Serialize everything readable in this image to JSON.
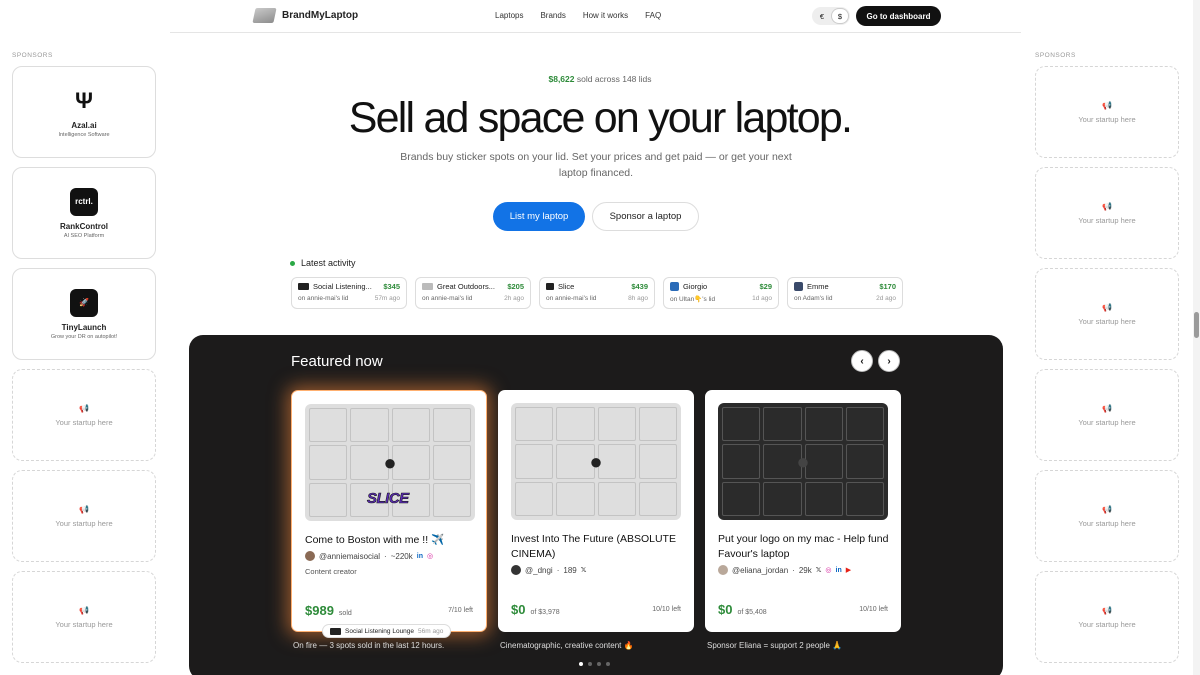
{
  "header": {
    "brand": "BrandMyLaptop",
    "nav": [
      "Laptops",
      "Brands",
      "How it works",
      "FAQ"
    ],
    "currency": {
      "options": [
        "€",
        "$"
      ],
      "selected": "$"
    },
    "dashboard_label": "Go to dashboard"
  },
  "sponsors": {
    "label": "SPONSORS",
    "left": [
      {
        "name": "Azal.ai",
        "tagline": "Intelligence Software",
        "logo": "Ψ"
      },
      {
        "name": "RankControl",
        "tagline": "AI SEO Platform",
        "logo": "rctrl."
      },
      {
        "name": "TinyLaunch",
        "tagline": "Grow your DR on autopilot!",
        "logo": "🚀"
      }
    ],
    "placeholder": "Your startup here",
    "placeholder_icon": "megaphone-icon"
  },
  "hero": {
    "stat_amount": "$8,622",
    "stat_rest": "sold across 148 lids",
    "title": "Sell ad space on your laptop.",
    "subtitle": "Brands buy sticker spots on your lid. Set your prices and get paid — or get your next laptop financed.",
    "cta_primary": "List my laptop",
    "cta_secondary": "Sponsor a laptop"
  },
  "activity": {
    "title": "Latest activity",
    "items": [
      {
        "name": "Social Listening...",
        "price": "$345",
        "lid": "on annie-mai's lid",
        "ago": "57m ago"
      },
      {
        "name": "Great Outdoors...",
        "price": "$205",
        "lid": "on annie-mai's lid",
        "ago": "2h ago"
      },
      {
        "name": "Slice",
        "price": "$439",
        "lid": "on annie-mai's lid",
        "ago": "8h ago"
      },
      {
        "name": "Giorgio",
        "price": "$29",
        "lid": "on Ultan👇's lid",
        "ago": "1d ago"
      },
      {
        "name": "Emme",
        "price": "$170",
        "lid": "on Adam's lid",
        "ago": "2d ago"
      }
    ]
  },
  "featured": {
    "title": "Featured now",
    "cards": [
      {
        "title": "Come to Boston with me !! ✈️",
        "handle": "@anniemaisocial",
        "followers": "~220k",
        "role": "Content creator",
        "price": "$989",
        "price_note": "sold",
        "left": "7/10 left",
        "caption": "On fire — 3 spots sold in the last 12 hours.",
        "sticker_text": "SLICE"
      },
      {
        "title": "Invest Into The Future (ABSOLUTE CINEMA)",
        "handle": "@_dngi",
        "followers": "189",
        "role": "",
        "price": "$0",
        "price_note": "of $3,978",
        "left": "10/10 left",
        "caption": "Cinematographic, creative content 🔥"
      },
      {
        "title": "Put your logo on my mac - Help fund Favour's laptop",
        "handle": "@eliana_jordan",
        "followers": "29k",
        "role": "",
        "price": "$0",
        "price_note": "of $5,408",
        "left": "10/10 left",
        "caption": "Sponsor Eliana = support 2 people 🙏"
      }
    ],
    "hot_pill": {
      "name": "Social Listening Lounge",
      "ago": "56m ago"
    }
  }
}
